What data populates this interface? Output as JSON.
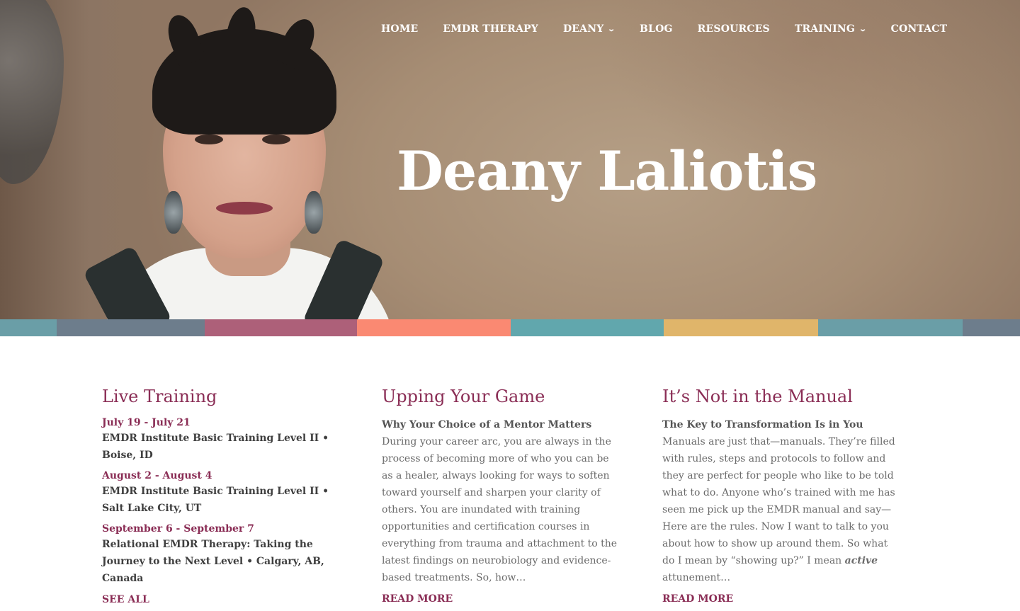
{
  "nav": {
    "items": [
      {
        "label": "HOME",
        "dropdown": false
      },
      {
        "label": "EMDR THERAPY",
        "dropdown": false
      },
      {
        "label": "DEANY",
        "dropdown": true
      },
      {
        "label": "BLOG",
        "dropdown": false
      },
      {
        "label": "RESOURCES",
        "dropdown": false
      },
      {
        "label": "TRAINING",
        "dropdown": true
      },
      {
        "label": "CONTACT",
        "dropdown": false
      }
    ]
  },
  "hero": {
    "title": "Deany Laliotis"
  },
  "color_band": [
    {
      "color": "#6a9ea7"
    },
    {
      "color": "#6d7d8c"
    },
    {
      "color": "#ad6079"
    },
    {
      "color": "#fa8972"
    },
    {
      "color": "#61a7ad"
    },
    {
      "color": "#e0b56a"
    },
    {
      "color": "#6a9ea7"
    },
    {
      "color": "#6d7d8c"
    }
  ],
  "live_training": {
    "heading": "Live Training",
    "events": [
      {
        "date": "July 19 - July 21",
        "title": "EMDR Institute Basic Training Level II • Boise, ID"
      },
      {
        "date": "August 2 - August 4",
        "title": "EMDR Institute Basic Training Level II • Salt Lake City, UT"
      },
      {
        "date": "September 6 - September 7",
        "title": "Relational EMDR Therapy: Taking the Journey to the Next Level • Calgary, AB, Canada"
      }
    ],
    "see_all": "SEE ALL"
  },
  "upping": {
    "heading": "Upping Your Game",
    "subheading": "Why Your Choice of a Mentor Matters",
    "body": "During your career arc, you are always in the process of becoming more of who you can be as a healer, always looking for ways to soften toward yourself and sharpen your clarity of others. You are inundated with training opportunities and certification courses in everything from trauma and attachment to the latest findings on neurobiology and evidence-based treatments. So, how…",
    "read_more": "READ MORE"
  },
  "manual": {
    "heading": "It’s Not in the Manual",
    "subheading": "The Key to Transformation Is in You",
    "body_before": "Manuals are just that—manuals. They’re filled with rules, steps and protocols to follow and they are perfect for people who like to be told what to do. Anyone who’s trained with me has seen me pick up the EMDR manual and say—Here are the rules. Now I want to talk to you about how to show up around them. So what do I mean by “showing up?” I mean ",
    "body_emphasis": "active",
    "body_after": " attunement…",
    "read_more": "READ MORE"
  }
}
